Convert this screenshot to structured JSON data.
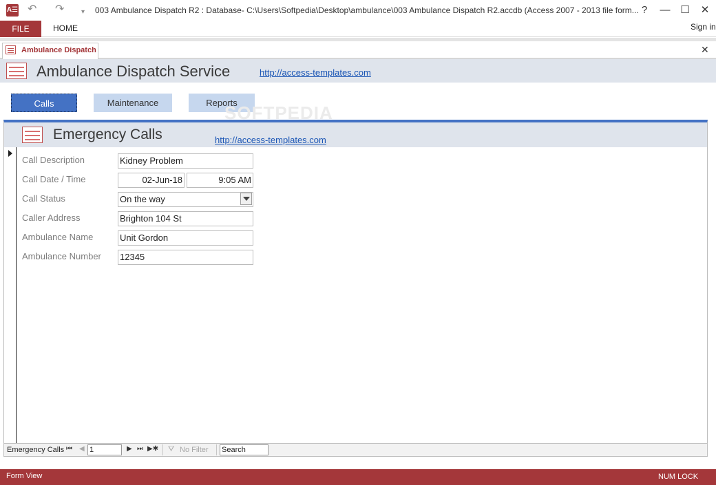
{
  "window": {
    "title": "003 Ambulance Dispatch R2 : Database- C:\\Users\\Softpedia\\Desktop\\ambulance\\003 Ambulance Dispatch R2.accdb (Access 2007 - 2013 file form...",
    "app_icon": "A☰",
    "undo_icon": "↶",
    "redo_icon": "↷",
    "customize_icon": "▾",
    "help": "?",
    "minimize": "—",
    "maximize": "☐",
    "close": "✕"
  },
  "ribbon": {
    "file": "FILE",
    "home": "HOME",
    "sign_in": "Sign in"
  },
  "document_tab": {
    "label": "Ambulance Dispatch",
    "close": "✕"
  },
  "form": {
    "title": "Ambulance Dispatch Service",
    "link": "http://access-templates.com",
    "nav_buttons": {
      "calls": "Calls",
      "maintenance": "Maintenance",
      "reports": "Reports"
    },
    "watermark": "SOFTPEDIA"
  },
  "subform": {
    "title": "Emergency Calls",
    "link": "http://access-templates.com",
    "labels": {
      "description": "Call Description",
      "date_time": "Call Date / Time",
      "status": "Call Status",
      "address": "Caller Address",
      "ambulance_name": "Ambulance Name",
      "ambulance_number": "Ambulance Number"
    },
    "values": {
      "description": "Kidney Problem",
      "date": "02-Jun-18",
      "time": "9:05 AM",
      "status": "On the way",
      "address": "Brighton 104 St",
      "ambulance_name": "Unit Gordon",
      "ambulance_number": "12345"
    }
  },
  "record_nav": {
    "label": "Emergency Calls",
    "first": "⏮",
    "prev": "◀",
    "record": "1",
    "next": "▶",
    "last": "⏭",
    "new": "▶✱",
    "filter_icon": "⛛",
    "filter": "No Filter",
    "search": "Search"
  },
  "status": {
    "left": "Form View",
    "right": "NUM LOCK"
  },
  "colors": {
    "accent": "#a4373a",
    "button_active": "#4472c4",
    "button_inactive": "#c6d7ee",
    "header_band": "#dfe4ec",
    "link": "#1a55b5"
  }
}
